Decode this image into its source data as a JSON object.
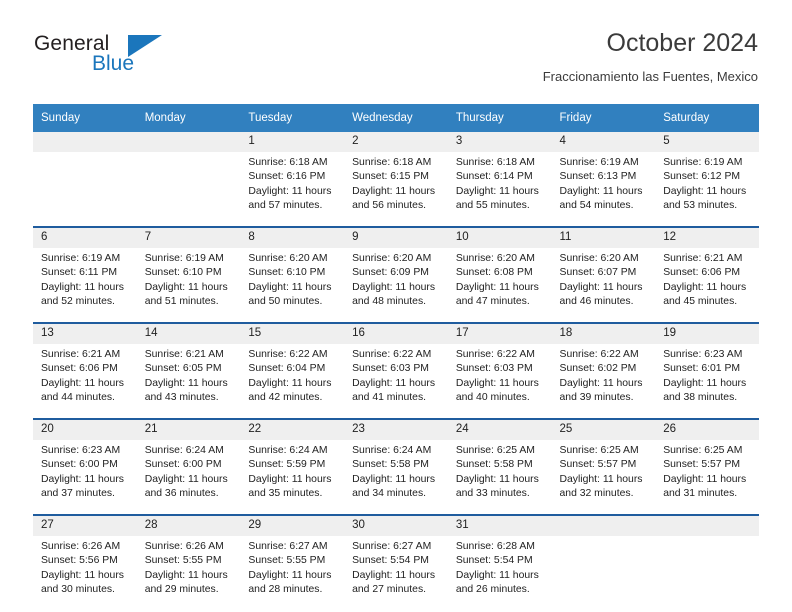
{
  "brand": {
    "name_part1": "General",
    "name_part2": "Blue",
    "color_primary": "#1b76bc",
    "triangle_icon": "triangle-icon"
  },
  "header": {
    "title": "October 2024",
    "subtitle": "Fraccionamiento las Fuentes, Mexico"
  },
  "calendar": {
    "header_bg": "#3180bf",
    "daynum_bg": "#efefef",
    "separator_color": "#1f5c9e",
    "weekdays": [
      "Sunday",
      "Monday",
      "Tuesday",
      "Wednesday",
      "Thursday",
      "Friday",
      "Saturday"
    ],
    "weeks": [
      {
        "days": [
          {
            "num": "",
            "sunrise": "",
            "sunset": "",
            "daylight1": "",
            "daylight2": ""
          },
          {
            "num": "",
            "sunrise": "",
            "sunset": "",
            "daylight1": "",
            "daylight2": ""
          },
          {
            "num": "1",
            "sunrise": "Sunrise: 6:18 AM",
            "sunset": "Sunset: 6:16 PM",
            "daylight1": "Daylight: 11 hours",
            "daylight2": "and 57 minutes."
          },
          {
            "num": "2",
            "sunrise": "Sunrise: 6:18 AM",
            "sunset": "Sunset: 6:15 PM",
            "daylight1": "Daylight: 11 hours",
            "daylight2": "and 56 minutes."
          },
          {
            "num": "3",
            "sunrise": "Sunrise: 6:18 AM",
            "sunset": "Sunset: 6:14 PM",
            "daylight1": "Daylight: 11 hours",
            "daylight2": "and 55 minutes."
          },
          {
            "num": "4",
            "sunrise": "Sunrise: 6:19 AM",
            "sunset": "Sunset: 6:13 PM",
            "daylight1": "Daylight: 11 hours",
            "daylight2": "and 54 minutes."
          },
          {
            "num": "5",
            "sunrise": "Sunrise: 6:19 AM",
            "sunset": "Sunset: 6:12 PM",
            "daylight1": "Daylight: 11 hours",
            "daylight2": "and 53 minutes."
          }
        ]
      },
      {
        "days": [
          {
            "num": "6",
            "sunrise": "Sunrise: 6:19 AM",
            "sunset": "Sunset: 6:11 PM",
            "daylight1": "Daylight: 11 hours",
            "daylight2": "and 52 minutes."
          },
          {
            "num": "7",
            "sunrise": "Sunrise: 6:19 AM",
            "sunset": "Sunset: 6:10 PM",
            "daylight1": "Daylight: 11 hours",
            "daylight2": "and 51 minutes."
          },
          {
            "num": "8",
            "sunrise": "Sunrise: 6:20 AM",
            "sunset": "Sunset: 6:10 PM",
            "daylight1": "Daylight: 11 hours",
            "daylight2": "and 50 minutes."
          },
          {
            "num": "9",
            "sunrise": "Sunrise: 6:20 AM",
            "sunset": "Sunset: 6:09 PM",
            "daylight1": "Daylight: 11 hours",
            "daylight2": "and 48 minutes."
          },
          {
            "num": "10",
            "sunrise": "Sunrise: 6:20 AM",
            "sunset": "Sunset: 6:08 PM",
            "daylight1": "Daylight: 11 hours",
            "daylight2": "and 47 minutes."
          },
          {
            "num": "11",
            "sunrise": "Sunrise: 6:20 AM",
            "sunset": "Sunset: 6:07 PM",
            "daylight1": "Daylight: 11 hours",
            "daylight2": "and 46 minutes."
          },
          {
            "num": "12",
            "sunrise": "Sunrise: 6:21 AM",
            "sunset": "Sunset: 6:06 PM",
            "daylight1": "Daylight: 11 hours",
            "daylight2": "and 45 minutes."
          }
        ]
      },
      {
        "days": [
          {
            "num": "13",
            "sunrise": "Sunrise: 6:21 AM",
            "sunset": "Sunset: 6:06 PM",
            "daylight1": "Daylight: 11 hours",
            "daylight2": "and 44 minutes."
          },
          {
            "num": "14",
            "sunrise": "Sunrise: 6:21 AM",
            "sunset": "Sunset: 6:05 PM",
            "daylight1": "Daylight: 11 hours",
            "daylight2": "and 43 minutes."
          },
          {
            "num": "15",
            "sunrise": "Sunrise: 6:22 AM",
            "sunset": "Sunset: 6:04 PM",
            "daylight1": "Daylight: 11 hours",
            "daylight2": "and 42 minutes."
          },
          {
            "num": "16",
            "sunrise": "Sunrise: 6:22 AM",
            "sunset": "Sunset: 6:03 PM",
            "daylight1": "Daylight: 11 hours",
            "daylight2": "and 41 minutes."
          },
          {
            "num": "17",
            "sunrise": "Sunrise: 6:22 AM",
            "sunset": "Sunset: 6:03 PM",
            "daylight1": "Daylight: 11 hours",
            "daylight2": "and 40 minutes."
          },
          {
            "num": "18",
            "sunrise": "Sunrise: 6:22 AM",
            "sunset": "Sunset: 6:02 PM",
            "daylight1": "Daylight: 11 hours",
            "daylight2": "and 39 minutes."
          },
          {
            "num": "19",
            "sunrise": "Sunrise: 6:23 AM",
            "sunset": "Sunset: 6:01 PM",
            "daylight1": "Daylight: 11 hours",
            "daylight2": "and 38 minutes."
          }
        ]
      },
      {
        "days": [
          {
            "num": "20",
            "sunrise": "Sunrise: 6:23 AM",
            "sunset": "Sunset: 6:00 PM",
            "daylight1": "Daylight: 11 hours",
            "daylight2": "and 37 minutes."
          },
          {
            "num": "21",
            "sunrise": "Sunrise: 6:24 AM",
            "sunset": "Sunset: 6:00 PM",
            "daylight1": "Daylight: 11 hours",
            "daylight2": "and 36 minutes."
          },
          {
            "num": "22",
            "sunrise": "Sunrise: 6:24 AM",
            "sunset": "Sunset: 5:59 PM",
            "daylight1": "Daylight: 11 hours",
            "daylight2": "and 35 minutes."
          },
          {
            "num": "23",
            "sunrise": "Sunrise: 6:24 AM",
            "sunset": "Sunset: 5:58 PM",
            "daylight1": "Daylight: 11 hours",
            "daylight2": "and 34 minutes."
          },
          {
            "num": "24",
            "sunrise": "Sunrise: 6:25 AM",
            "sunset": "Sunset: 5:58 PM",
            "daylight1": "Daylight: 11 hours",
            "daylight2": "and 33 minutes."
          },
          {
            "num": "25",
            "sunrise": "Sunrise: 6:25 AM",
            "sunset": "Sunset: 5:57 PM",
            "daylight1": "Daylight: 11 hours",
            "daylight2": "and 32 minutes."
          },
          {
            "num": "26",
            "sunrise": "Sunrise: 6:25 AM",
            "sunset": "Sunset: 5:57 PM",
            "daylight1": "Daylight: 11 hours",
            "daylight2": "and 31 minutes."
          }
        ]
      },
      {
        "days": [
          {
            "num": "27",
            "sunrise": "Sunrise: 6:26 AM",
            "sunset": "Sunset: 5:56 PM",
            "daylight1": "Daylight: 11 hours",
            "daylight2": "and 30 minutes."
          },
          {
            "num": "28",
            "sunrise": "Sunrise: 6:26 AM",
            "sunset": "Sunset: 5:55 PM",
            "daylight1": "Daylight: 11 hours",
            "daylight2": "and 29 minutes."
          },
          {
            "num": "29",
            "sunrise": "Sunrise: 6:27 AM",
            "sunset": "Sunset: 5:55 PM",
            "daylight1": "Daylight: 11 hours",
            "daylight2": "and 28 minutes."
          },
          {
            "num": "30",
            "sunrise": "Sunrise: 6:27 AM",
            "sunset": "Sunset: 5:54 PM",
            "daylight1": "Daylight: 11 hours",
            "daylight2": "and 27 minutes."
          },
          {
            "num": "31",
            "sunrise": "Sunrise: 6:28 AM",
            "sunset": "Sunset: 5:54 PM",
            "daylight1": "Daylight: 11 hours",
            "daylight2": "and 26 minutes."
          },
          {
            "num": "",
            "sunrise": "",
            "sunset": "",
            "daylight1": "",
            "daylight2": ""
          },
          {
            "num": "",
            "sunrise": "",
            "sunset": "",
            "daylight1": "",
            "daylight2": ""
          }
        ]
      }
    ]
  }
}
